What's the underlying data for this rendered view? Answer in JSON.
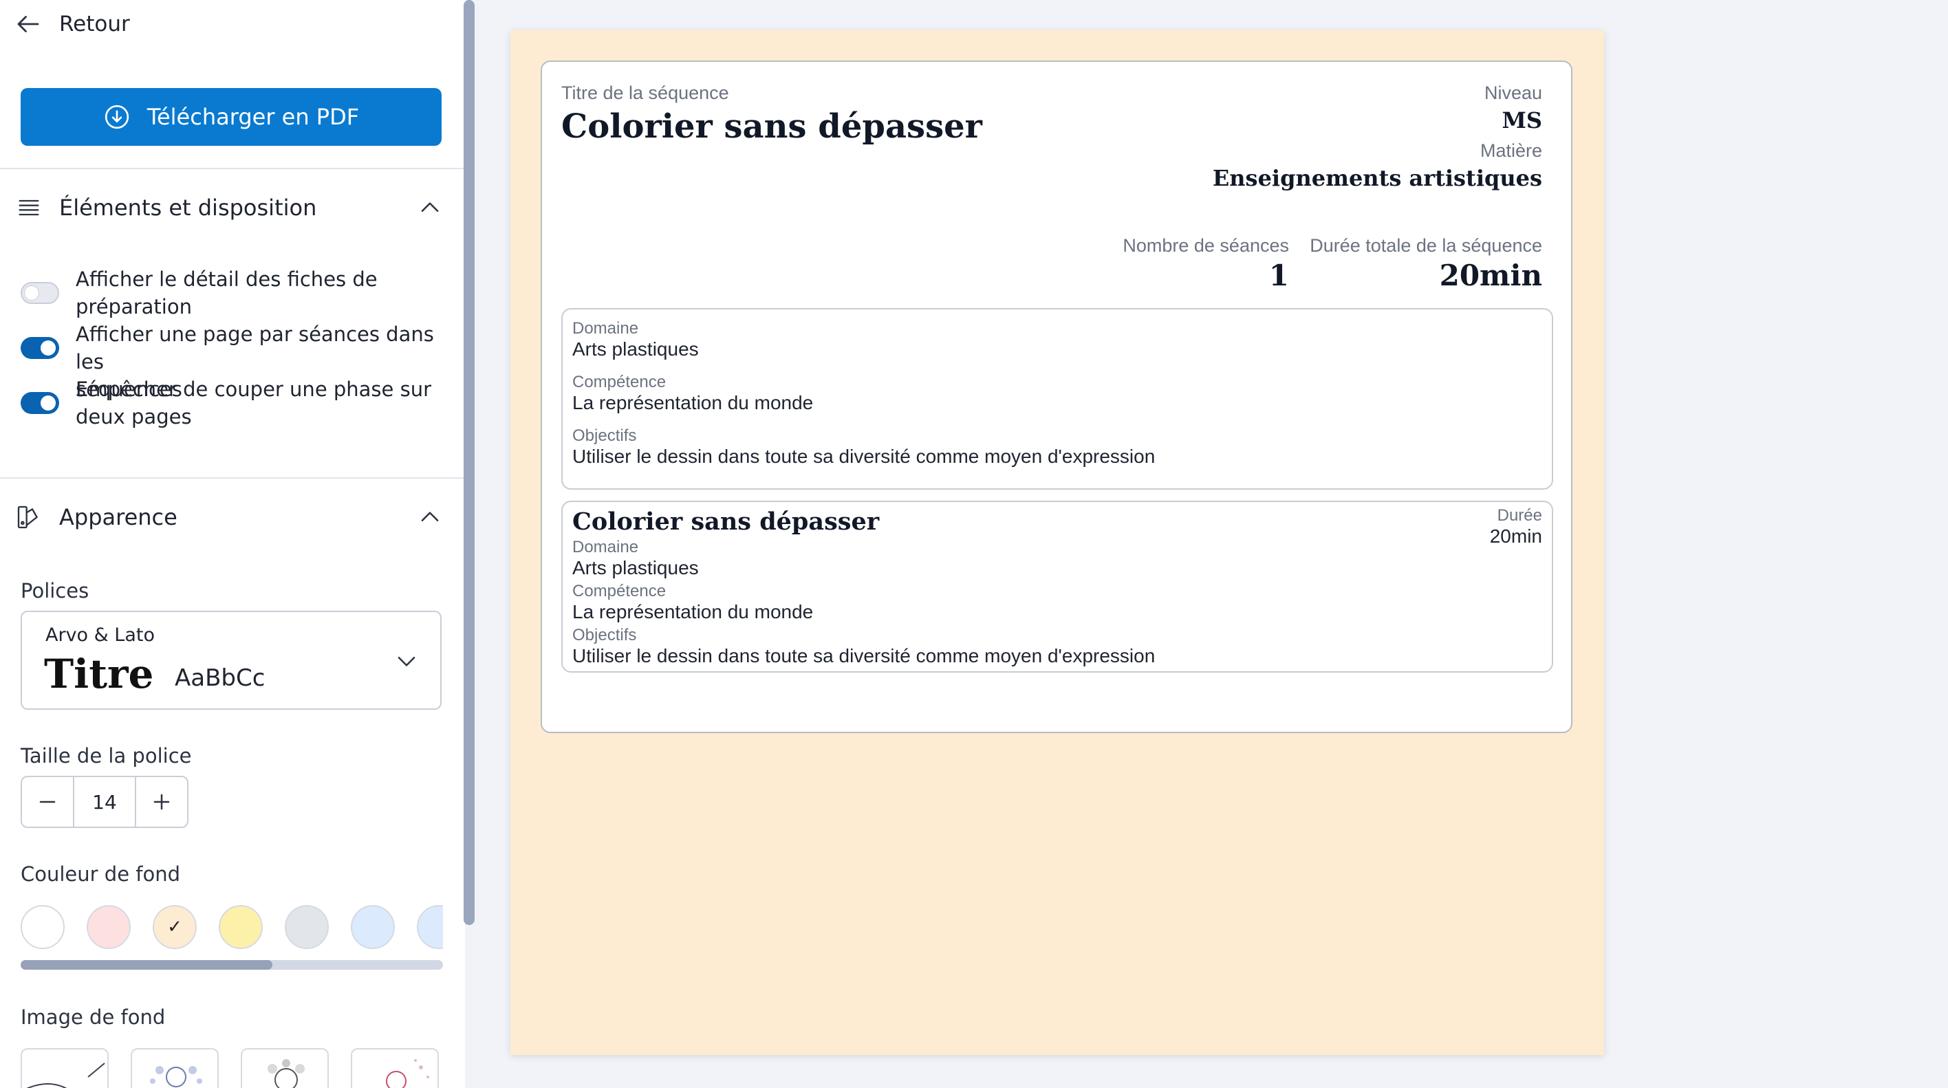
{
  "sidebar": {
    "back_label": "Retour",
    "download_label": "Télécharger en PDF",
    "layout_section": {
      "title": "Éléments et disposition",
      "toggles": [
        {
          "line1": "Afficher le détail des fiches de",
          "line2": "préparation",
          "on": false
        },
        {
          "line1": "Afficher une page par séances dans les",
          "line2": "séquences",
          "on": true
        },
        {
          "line1": "Empêcher de couper une phase sur",
          "line2": "deux pages",
          "on": true
        }
      ]
    },
    "appearance_section": {
      "title": "Apparence",
      "fonts_label": "Polices",
      "font_select": {
        "name": "Arvo & Lato",
        "title_sample": "Titre",
        "text_sample": "AaBbCc"
      },
      "font_size_label": "Taille de la police",
      "font_size_value": "14",
      "bg_color_label": "Couleur de fond",
      "bg_colors": [
        "#ffffff",
        "#fde0e0",
        "#fdecd2",
        "#fdf1a9",
        "#e2e6ea",
        "#dceafd",
        "#dceafd"
      ],
      "bg_color_selected_index": 2,
      "bg_color_check": "✓",
      "bg_image_label": "Image de fond"
    }
  },
  "preview": {
    "page_color": "#fdecd2",
    "sequence_title_label": "Titre de la séquence",
    "sequence_title": "Colorier sans dépasser",
    "level_label": "Niveau",
    "level_value": "MS",
    "subject_label": "Matière",
    "subject_value": "Enseignements artistiques",
    "sessions_label": "Nombre de séances",
    "sessions_value": "1",
    "duration_label": "Durée totale de la séquence",
    "duration_value": "20min",
    "summary": {
      "domain_label": "Domaine",
      "domain_value": "Arts plastiques",
      "competence_label": "Compétence",
      "competence_value": "La représentation du monde",
      "objectives_label": "Objectifs",
      "objectives_value": "Utiliser le dessin dans toute sa diversité comme moyen d'expression"
    },
    "session": {
      "title": "Colorier sans dépasser",
      "duration_label": "Durée",
      "duration_value": "20min",
      "domain_label": "Domaine",
      "domain_value": "Arts plastiques",
      "competence_label": "Compétence",
      "competence_value": "La représentation du monde",
      "objectives_label": "Objectifs",
      "objectives_value": "Utiliser le dessin dans toute sa diversité comme moyen d'expression"
    }
  }
}
